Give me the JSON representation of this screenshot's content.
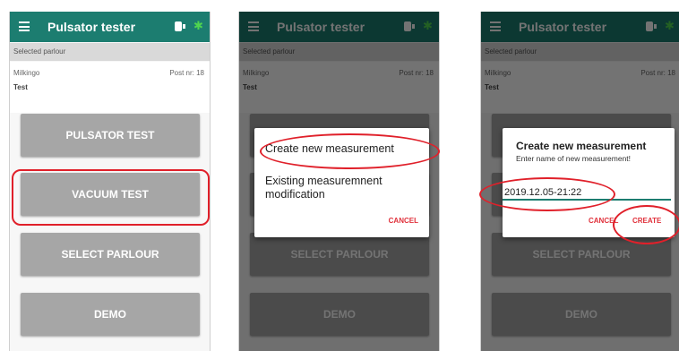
{
  "app": {
    "title": "Pulsator tester",
    "icons": {
      "menu": "menu-icon",
      "battery": "plug-icon",
      "bluetooth": "bluetooth-icon"
    },
    "colors": {
      "appbar": "#1c7d70",
      "accent_red": "#e0303a",
      "button_gray": "#a6a6a6",
      "bluetooth": "#4fd54f"
    }
  },
  "parlour": {
    "section_label": "Selected parlour",
    "name": "Milkingo",
    "post": "Post nr: 18",
    "sub": "Test"
  },
  "buttons": {
    "pulsator_test": "PULSATOR TEST",
    "vacuum_test": "VACUUM TEST",
    "select_parlour": "SELECT PARLOUR",
    "demo": "DEMO"
  },
  "dialog_choice": {
    "option_new": "Create new measurement",
    "option_existing": "Existing measuremnent modification",
    "cancel": "CANCEL"
  },
  "dialog_create": {
    "title": "Create new measurement",
    "subtitle": "Enter name of new measurement!",
    "input_value": "2019.12.05-21:22",
    "cancel": "CANCEL",
    "create": "CREATE"
  }
}
